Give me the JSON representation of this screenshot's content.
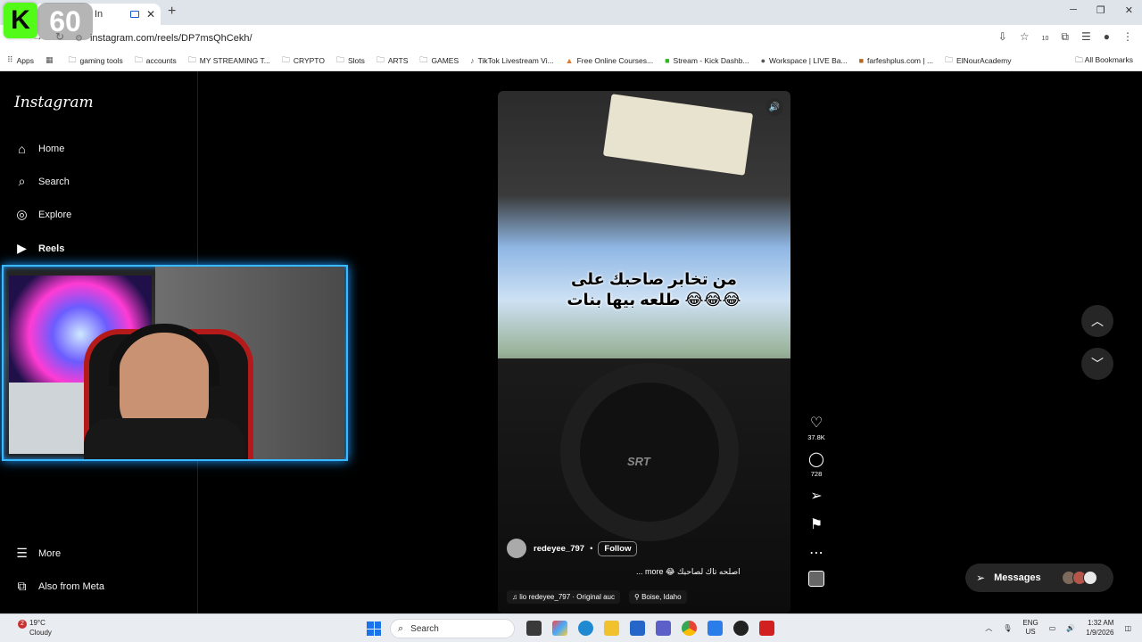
{
  "browser": {
    "tab_title": "In",
    "url": "instagram.com/reels/DP7msQhCekh/",
    "overlay_number": "60",
    "kick_logo": "K",
    "bookmarks": [
      {
        "label": "Apps"
      },
      {
        "label": "gaming tools"
      },
      {
        "label": "accounts"
      },
      {
        "label": "MY STREAMING T..."
      },
      {
        "label": "CRYPTO"
      },
      {
        "label": "Slots"
      },
      {
        "label": "ARTS"
      },
      {
        "label": "GAMES"
      },
      {
        "label": "TikTok Livestream Vi..."
      },
      {
        "label": "Free Online Courses..."
      },
      {
        "label": "Stream - Kick Dashb..."
      },
      {
        "label": "Workspace | LIVE Ba..."
      },
      {
        "label": "farfeshplus.com | ..."
      },
      {
        "label": "ElNourAcademy"
      }
    ],
    "all_bookmarks": "All Bookmarks",
    "extensions_badge": "10"
  },
  "instagram": {
    "logo": "Instagram",
    "nav": {
      "home": "Home",
      "search": "Search",
      "explore": "Explore",
      "reels": "Reels",
      "more": "More",
      "meta": "Also from Meta"
    },
    "reel": {
      "overlay_text_line1": "من تخابر صاحبك على",
      "overlay_text_line2": "طلعه بيها بنات 😂😂😂",
      "username": "redeyee_797",
      "dot": "•",
      "follow": "Follow",
      "caption": "... more 😂 اصلحه تاك لصاحبك",
      "audio": "lio  redeyee_797 · Original auc",
      "location": "Boise, Idaho",
      "wheel_logo": "SRT"
    },
    "actions": {
      "likes": "37.8K",
      "comments": "728"
    },
    "messages": "Messages"
  },
  "taskbar": {
    "weather_temp": "19°C",
    "weather_desc": "Cloudy",
    "weather_badge": "2",
    "search": "Search",
    "lang1": "ENG",
    "lang2": "US",
    "time": "1:32 AM",
    "date": "1/9/2026"
  },
  "colors": {
    "webcam_border": "#39b9ff",
    "kick_green": "#53fc18",
    "ig_bg": "#000000"
  }
}
